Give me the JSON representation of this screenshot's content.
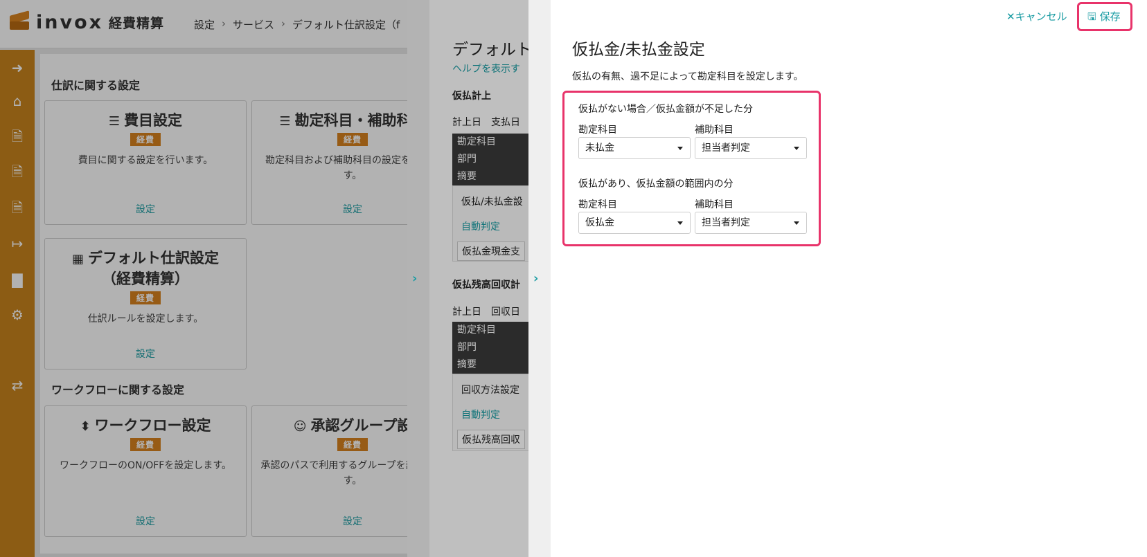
{
  "header": {
    "logo_text": "invox",
    "logo_sub": "経費精算",
    "breadcrumb": [
      "設定",
      "サービス",
      "デフォルト仕訳設定（f"
    ]
  },
  "sidebar": {
    "icons": [
      "arrow-right-circle-icon",
      "home-icon",
      "document-icon",
      "document-icon",
      "document-icon",
      "file-export-icon",
      "chart-icon",
      "gear-icon",
      "exchange-icon"
    ]
  },
  "main": {
    "journal_section_title": "仕訳に関する設定",
    "workflow_section_title": "ワークフローに関する設定",
    "cards": [
      {
        "title": "費目設定",
        "badge": "経費",
        "desc": "費目に関する設定を行います。",
        "link": "設定",
        "icon": "list-icon"
      },
      {
        "title": "勘定科目・補助科目",
        "badge": "経費",
        "desc": "勘定科目および補助科目の設定を行います。",
        "link": "設定",
        "icon": "list-icon"
      },
      {
        "title": "デフォルト仕訳設定",
        "title2": "（経費精算）",
        "badge": "経費",
        "desc": "仕訳ルールを設定します。",
        "link": "設定",
        "icon": "table-icon"
      },
      {
        "title": "ワークフロー設定",
        "badge": "経費",
        "desc": "ワークフローのON/OFFを設定します。",
        "link": "設定",
        "icon": "workflow-icon"
      },
      {
        "title": "承認グループ設",
        "badge": "経費",
        "desc": "承認のパスで利用するグループを設定します。",
        "link": "設定",
        "icon": "users-icon"
      }
    ]
  },
  "middle_panel": {
    "title": "デフォルト",
    "help": "ヘルプを表示す",
    "section1": "仮払計上",
    "section1_cols": "計上日　支払日",
    "section1_rows": [
      "勘定科目",
      "部門",
      "摘要"
    ],
    "section1_item": "仮払/未払金設",
    "section1_auto": "自動判定",
    "section1_tag": "仮払金現金支",
    "section2": "仮払残高回収計",
    "section2_cols": "計上日　回収日",
    "section2_rows": [
      "勘定科目",
      "部門",
      "摘要"
    ],
    "section2_item": "回収方法設定",
    "section2_auto": "自動判定",
    "section2_tag": "仮払残高回収"
  },
  "dialog": {
    "cancel_label": "キャンセル",
    "save_label": "保存",
    "title": "仮払金/未払金設定",
    "description": "仮払の有無、過不足によって勘定科目を設定します。",
    "groups": [
      {
        "heading": "仮払がない場合／仮払金額が不足した分",
        "account_label": "勘定科目",
        "account_value": "未払金",
        "sub_label": "補助科目",
        "sub_value": "担当者判定"
      },
      {
        "heading": "仮払があり、仮払金額の範囲内の分",
        "account_label": "勘定科目",
        "account_value": "仮払金",
        "sub_label": "補助科目",
        "sub_value": "担当者判定"
      }
    ]
  },
  "colors": {
    "accent": "#1a9ca3",
    "brand": "#c9841e",
    "highlight": "#e8336a"
  }
}
